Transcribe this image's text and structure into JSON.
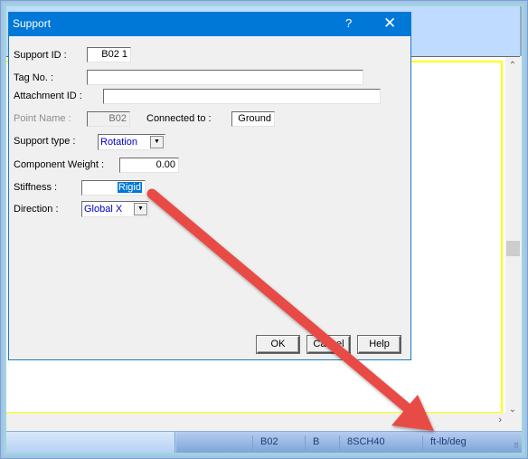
{
  "dialog": {
    "title": "Support",
    "help_glyph": "?",
    "close_glyph": "✕",
    "fields": {
      "support_id": {
        "label": "Support ID :",
        "value": "B02  1"
      },
      "tag_no": {
        "label": "Tag No. :",
        "value": ""
      },
      "attachment_id": {
        "label": "Attachment ID :",
        "value": ""
      },
      "point_name": {
        "label": "Point Name :",
        "value": "B02"
      },
      "connected_to": {
        "label": "Connected to :",
        "value": "Ground"
      },
      "support_type": {
        "label": "Support type :",
        "value": "Rotation"
      },
      "component_weight": {
        "label": "Component Weight :",
        "value": "0.00"
      },
      "stiffness": {
        "label": "Stiffness :",
        "value": "Rigid"
      },
      "direction": {
        "label": "Direction :",
        "value": "Global X"
      }
    },
    "buttons": {
      "ok": "OK",
      "cancel": "Cancel",
      "help": "Help"
    }
  },
  "statusbar": {
    "cells": [
      "B02",
      "B",
      "8SCH40",
      "ft-lb/deg"
    ]
  },
  "scroll": {
    "up": "⌃",
    "down": "⌄",
    "right": "›"
  },
  "annotation": {
    "color": "#e84b45",
    "description": "arrow pointing from Stiffness field to status bar units"
  }
}
